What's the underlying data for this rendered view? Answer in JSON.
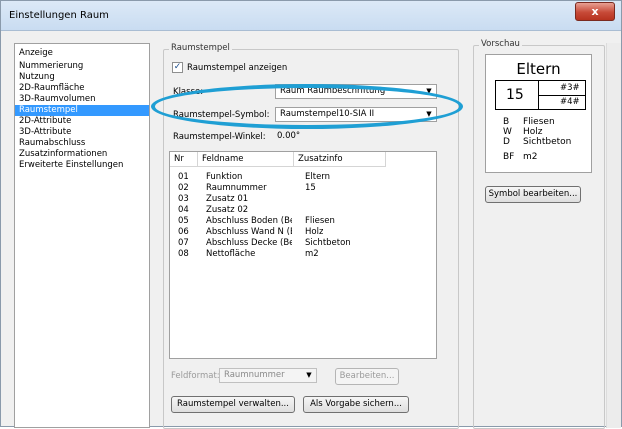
{
  "window": {
    "title": "Einstellungen Raum",
    "close_label": "x"
  },
  "nav": {
    "items": [
      "Anzeige",
      "Nummerierung",
      "Nutzung",
      "2D-Raumfläche",
      "3D-Raumvolumen",
      "Raumstempel",
      "2D-Attribute",
      "3D-Attribute",
      "Raumabschluss",
      "Zusatzinformationen",
      "Erweiterte Einstellungen"
    ],
    "selected": "Raumstempel"
  },
  "raumstempel": {
    "group_label": "Raumstempel",
    "show_checkbox_label": "Raumstempel anzeigen",
    "show_checked": true,
    "klasse_label": "Klasse:",
    "klasse_value": "Raum Raumbeschriftung",
    "symbol_label": "Raumstempel-Symbol:",
    "symbol_value": "Raumstempel10-SIA II",
    "winkel_label": "Raumstempel-Winkel:",
    "winkel_value": "0.00°"
  },
  "table": {
    "headers": [
      "Nr",
      "Feldname",
      "Zusatzinfo"
    ],
    "rows": [
      {
        "nr": "01",
        "feldname": "Funktion",
        "zusatzinfo": "Eltern"
      },
      {
        "nr": "02",
        "feldname": "Raumnummer",
        "zusatzinfo": "15"
      },
      {
        "nr": "03",
        "feldname": "Zusatz 01",
        "zusatzinfo": ""
      },
      {
        "nr": "04",
        "feldname": "Zusatz 02",
        "zusatzinfo": ""
      },
      {
        "nr": "05",
        "feldname": "Abschluss Boden (Besc",
        "zusatzinfo": "Fliesen"
      },
      {
        "nr": "06",
        "feldname": "Abschluss Wand N (Be:",
        "zusatzinfo": "Holz"
      },
      {
        "nr": "07",
        "feldname": "Abschluss Decke (Besc",
        "zusatzinfo": "Sichtbeton"
      },
      {
        "nr": "08",
        "feldname": "Nettofläche",
        "zusatzinfo": "m2"
      }
    ]
  },
  "footer": {
    "feldformat_label": "Feldformat:",
    "feldformat_value": "Raumnummer",
    "bearbeiten_label": "Bearbeiten...",
    "verwalten_label": "Raumstempel verwalten...",
    "vorgabe_label": "Als Vorgabe sichern..."
  },
  "preview": {
    "group_label": "Vorschau",
    "name": "Eltern",
    "number": "15",
    "field3": "#3#",
    "field4": "#4#",
    "lines": [
      {
        "key": "B",
        "value": "Fliesen"
      },
      {
        "key": "W",
        "value": "Holz"
      },
      {
        "key": "D",
        "value": "Sichtbeton"
      }
    ],
    "bf_key": "BF",
    "bf_value": "m2",
    "edit_button_label": "Symbol bearbeiten..."
  },
  "colors": {
    "selection": "#3399ff",
    "highlight_ellipse": "#1f9fd4"
  }
}
